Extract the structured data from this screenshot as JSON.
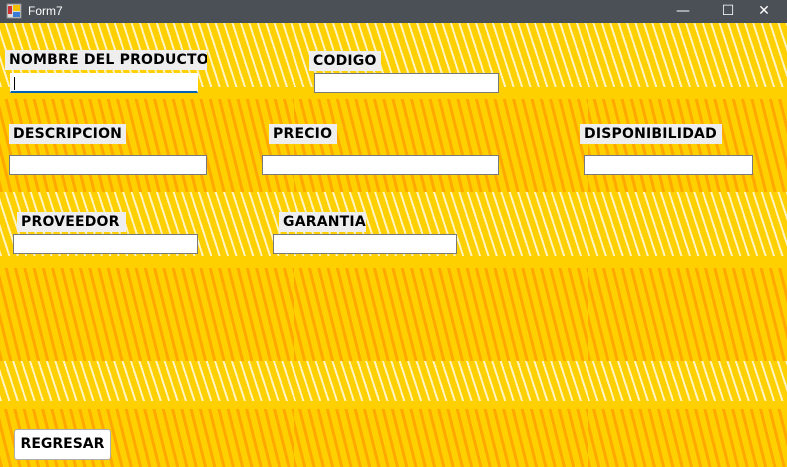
{
  "window": {
    "title": "Form7",
    "minimize": "—",
    "maximize": "☐",
    "close": "✕"
  },
  "form": {
    "nombre": {
      "label": "NOMBRE DEL PRODUCTO",
      "value": ""
    },
    "codigo": {
      "label": "CODIGO",
      "value": ""
    },
    "descripcion": {
      "label": "DESCRIPCION",
      "value": ""
    },
    "precio": {
      "label": "PRECIO",
      "value": ""
    },
    "disponibilidad": {
      "label": "DISPONIBILIDAD",
      "value": ""
    },
    "proveedor": {
      "label": "PROVEEDOR",
      "value": ""
    },
    "garantia": {
      "label": "GARANTIA",
      "value": ""
    }
  },
  "buttons": {
    "regresar": "REGRESAR"
  },
  "colors": {
    "background": "#ffd000",
    "titlebar": "#4a5056",
    "focus": "#0063b1"
  }
}
